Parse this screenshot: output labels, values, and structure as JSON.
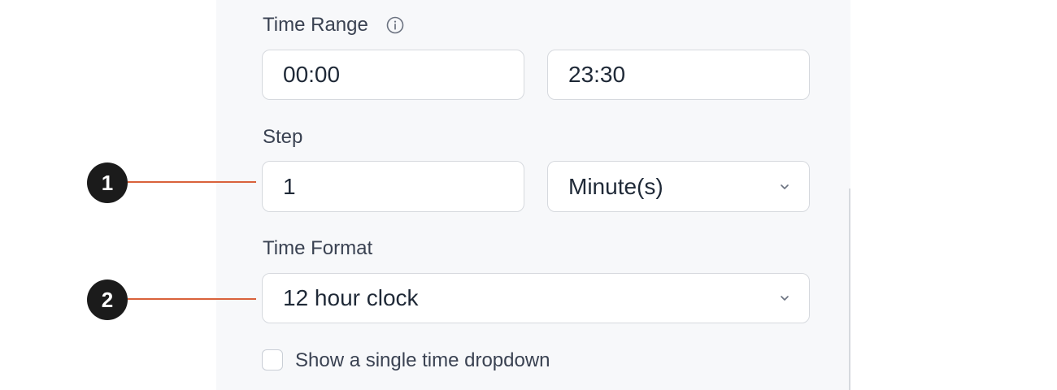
{
  "time_range": {
    "label": "Time Range",
    "start": "00:00",
    "end": "23:30",
    "info_icon": "info-icon"
  },
  "step": {
    "label": "Step",
    "value": "1",
    "unit": "Minute(s)"
  },
  "time_format": {
    "label": "Time Format",
    "value": "12 hour clock"
  },
  "single_dropdown": {
    "label": "Show a single time dropdown",
    "checked": false
  },
  "callouts": {
    "one": "1",
    "two": "2"
  },
  "colors": {
    "leader_line": "#d9623b",
    "callout_bg": "#1b1b1b",
    "panel_bg": "#f7f8fa"
  }
}
